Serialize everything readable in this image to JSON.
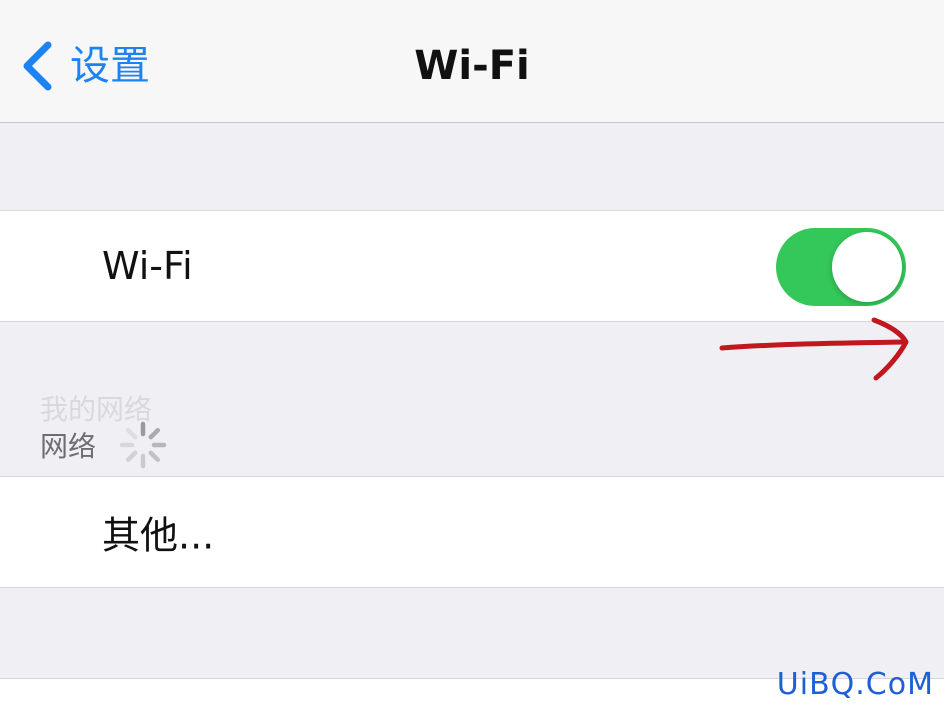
{
  "nav": {
    "back_label": "设置",
    "title": "Wi-Fi",
    "accent_color": "#1e83f2"
  },
  "wifi_cell": {
    "label": "Wi-Fi",
    "toggle_on": true,
    "toggle_color": "#34c759"
  },
  "networks": {
    "ghost_header": "我的网络",
    "section_label": "网络",
    "loading_icon": "spinner-icon"
  },
  "other_cell": {
    "label": "其他..."
  },
  "annotation": {
    "arrow_color": "#c0181e"
  },
  "watermark": {
    "text": "UiBQ.CoM",
    "color": "#1f5fd6"
  }
}
